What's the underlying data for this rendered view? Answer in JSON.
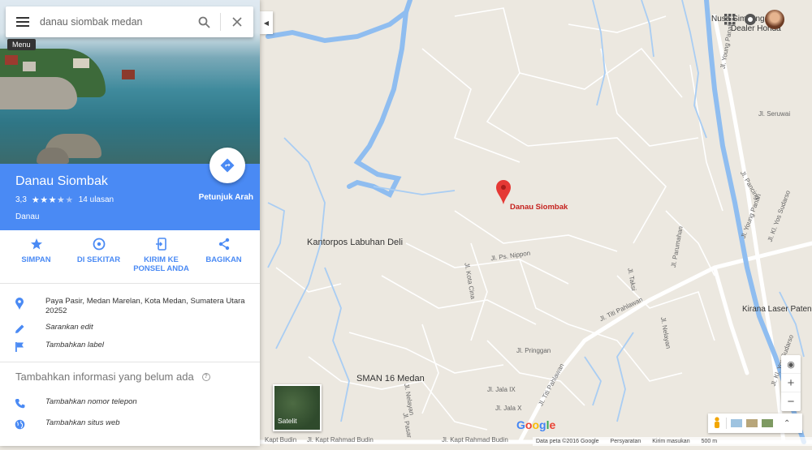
{
  "search": {
    "value": "danau siombak medan",
    "menu_tooltip": "Menu"
  },
  "place": {
    "title": "Danau Siombak",
    "rating": "3,3",
    "rating_value": 3.3,
    "review_count": "14 ulasan",
    "type": "Danau",
    "directions_label": "Petunjuk Arah"
  },
  "actions": [
    {
      "label": "SIMPAN",
      "icon": "star-icon"
    },
    {
      "label": "DI SEKITAR",
      "icon": "nearby-icon"
    },
    {
      "label": "KIRIM KE PONSEL ANDA",
      "icon": "send-to-phone-icon"
    },
    {
      "label": "BAGIKAN",
      "icon": "share-icon"
    }
  ],
  "info": {
    "address": "Paya Pasir, Medan Marelan, Kota Medan, Sumatera Utara 20252",
    "suggest_edit": "Sarankan edit",
    "add_label": "Tambahkan label"
  },
  "missing": {
    "title": "Tambahkan informasi yang belum ada",
    "add_phone": "Tambahkan nomor telepon",
    "add_website": "Tambahkan situs web"
  },
  "map": {
    "pin_label": "Danau Siombak",
    "labels": {
      "kantorpos": "Kantorpos Labuhan Deli",
      "sman": "SMAN 16 Medan",
      "kirana": "Kirana Laser Paten",
      "simpang": "Nusa Simpang Kan",
      "dealer": "Dealer Honda"
    },
    "streets": {
      "seruwai": "Jl. Seruwai",
      "nippon": "Jl. Ps. Nippon",
      "pringgan": "Jl. Pringgan",
      "jala9": "Jl. Jala IX",
      "jala10": "Jl. Jala X",
      "titi": "Jl. Titi Pahlawan",
      "titi2": "Jl. Titi Pahlawan",
      "budin": "Jl. Kapt Rahmad Budin",
      "budin2": "Jl. Kapt Rahmad Budin",
      "budin3": "Kapt Budin",
      "young": "Jl. Young Panah",
      "young2": "Jl. Young Panah",
      "yos": "Jl. Kl. Yos Sudarso",
      "yos2": "Jl. Kl. Yos Sudarso",
      "pancing": "Jl. Pancing",
      "kota": "Jl. Kota Cina",
      "taksi": "Jl. Taksi",
      "nelayan": "Jl. Nelayan",
      "parumahan": "Jl. Parumahan",
      "nelayan2": "Jl. Nelayan",
      "pasar": "Jl. Pasar"
    },
    "satellite_label": "Satelit",
    "google": "Google",
    "footer": {
      "data": "Data peta ©2016 Google",
      "terms": "Persyaratan",
      "feedback": "Kirim masukan",
      "scale": "500 m"
    }
  },
  "colors": {
    "accent": "#4a8af4",
    "water": "#a3c8f3",
    "river": "#74a9ea",
    "pin": "#e53935",
    "land": "#ece8e0",
    "road": "#ffffff"
  }
}
